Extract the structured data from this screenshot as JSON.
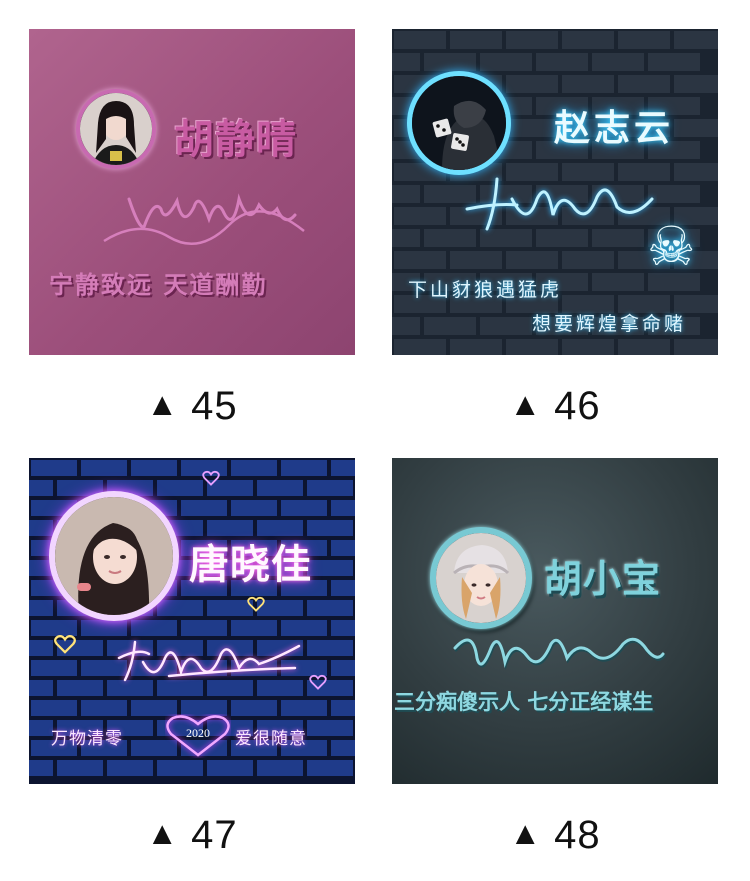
{
  "caption_prefix": "▲",
  "cards": [
    {
      "number": "45",
      "name": "胡静晴",
      "motto": "宁静致远 天道酬勤",
      "color": "#9c4f7b"
    },
    {
      "number": "46",
      "name": "赵志云",
      "line1": "下山豺狼遇猛虎",
      "line2": "想要辉煌拿命赌",
      "skull": "☠",
      "color": "#2fb6ff"
    },
    {
      "number": "47",
      "name": "唐晓佳",
      "motto_left": "万物清零",
      "year": "2020",
      "motto_right": "爱很随意",
      "color": "#d13cff"
    },
    {
      "number": "48",
      "name": "胡小宝",
      "motto": "三分痴傻示人 七分正经谋生",
      "color": "#7fd2dc"
    }
  ]
}
